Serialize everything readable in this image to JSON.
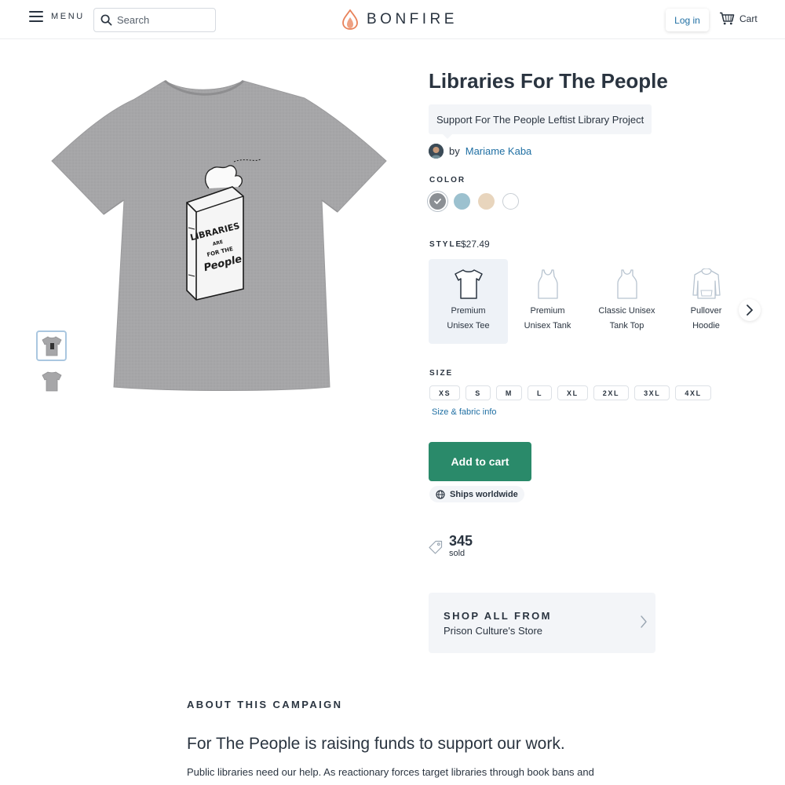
{
  "header": {
    "menu_label": "MENU",
    "search_placeholder": "Search",
    "logo_text": "BONFIRE",
    "login_label": "Log in",
    "cart_label": "Cart"
  },
  "product": {
    "title": "Libraries For The People",
    "subtitle": "Support For The People Leftist Library Project",
    "by_prefix": "by",
    "author": "Mariame Kaba",
    "color_label": "COLOR",
    "colors": [
      {
        "name": "heather-grey",
        "hex": "#8b8f94",
        "selected": true
      },
      {
        "name": "heather-blue",
        "hex": "#9cc1cf",
        "selected": false
      },
      {
        "name": "tan",
        "hex": "#e8d5bd",
        "selected": false
      },
      {
        "name": "white",
        "hex": "#ffffff",
        "selected": false
      }
    ],
    "style_label": "STYLE",
    "price": "$27.49",
    "styles": [
      {
        "line1": "Premium",
        "line2": "Unisex Tee",
        "icon": "tee-icon",
        "selected": true
      },
      {
        "line1": "Premium",
        "line2": "Unisex Tank",
        "icon": "tank-icon",
        "selected": false
      },
      {
        "line1": "Classic Unisex",
        "line2": "Tank Top",
        "icon": "tank-top-icon",
        "selected": false
      },
      {
        "line1": "Pullover",
        "line2": "Hoodie",
        "icon": "hoodie-icon",
        "selected": false
      }
    ],
    "size_label": "SIZE",
    "sizes": [
      "XS",
      "S",
      "M",
      "L",
      "XL",
      "2XL",
      "3XL",
      "4XL"
    ],
    "size_info": "Size & fabric info",
    "add_to_cart": "Add to cart",
    "ships": "Ships worldwide",
    "sold_count": "345",
    "sold_label": "sold",
    "shop_all_title": "SHOP ALL FROM",
    "shop_all_store": "Prison Culture's Store",
    "print_text": [
      "LIBRARIES",
      "ARE",
      "FOR THE",
      "People"
    ]
  },
  "about": {
    "label": "ABOUT THIS CAMPAIGN",
    "heading": "For The People is raising funds to support our work.",
    "body": "Public libraries need our help. As reactionary forces target libraries through book bans and"
  },
  "colors": {
    "accent_green": "#2a8a6a",
    "link_blue": "#1f6fa3",
    "logo_orange": "#e8825a",
    "text_dark": "#2a3440",
    "panel_bg": "#f3f5f8"
  }
}
